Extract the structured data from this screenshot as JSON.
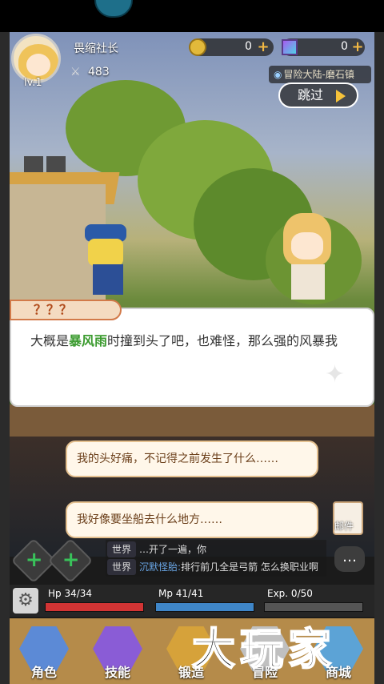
{
  "player": {
    "name": "畏缩社长",
    "level": "lv.1",
    "power": "483"
  },
  "currency": {
    "coins": "0",
    "gems": "0"
  },
  "location": "冒险大陆-磨石镇",
  "skip_label": "跳过",
  "dialog": {
    "speaker": "？？？",
    "text_before": "大概是",
    "text_highlight": "暴风雨",
    "text_after": "时撞到头了吧，也难怪，那么强的风暴我"
  },
  "choices": [
    {
      "label": "我的头好痛，不记得之前发生了什么……"
    },
    {
      "label": "我好像要坐船去什么地方……"
    }
  ],
  "mail_label": "邮件",
  "chat": [
    {
      "tag": "世界",
      "name": "",
      "msg": "…开了一遍，你"
    },
    {
      "tag": "世界",
      "name": "沉默怪胎:",
      "msg": "排行前几全是弓箭 怎么换职业啊"
    }
  ],
  "stats": {
    "hp_label": "Hp 34/34",
    "hp_fraction": 1.0,
    "mp_label": "Mp 41/41",
    "mp_fraction": 1.0,
    "exp_label": "Exp. 0/50",
    "exp_fraction": 0.0
  },
  "nav": [
    {
      "label": "角色",
      "color": "#5c8ad6"
    },
    {
      "label": "技能",
      "color": "#8a5cd6"
    },
    {
      "label": "锻造",
      "color": "#d6a23a"
    },
    {
      "label": "冒险",
      "color": "#c0c0c0"
    },
    {
      "label": "商城",
      "color": "#5ca3d6"
    }
  ],
  "colors": {
    "highlight": "#3b9b2f",
    "hp": "#d23434",
    "mp": "#3f86c8",
    "exp": "#9a9a9a"
  },
  "watermark": "大玩家"
}
